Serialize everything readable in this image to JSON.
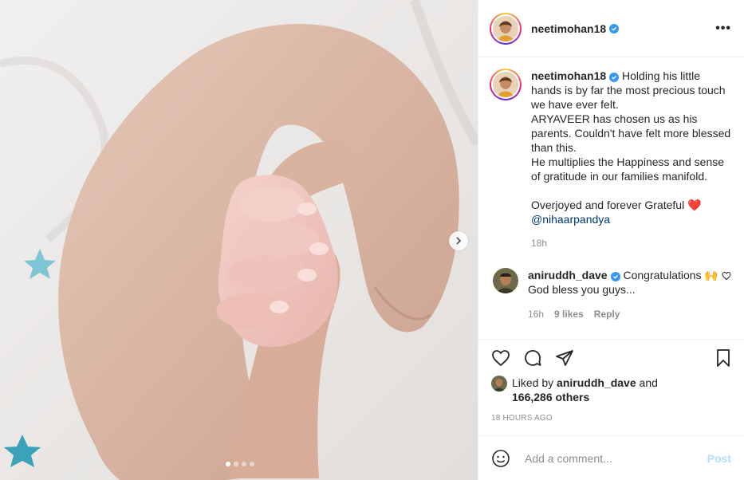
{
  "header": {
    "username": "neetimohan18",
    "more_icon": "ellipsis-icon",
    "more_label": "•••"
  },
  "caption": {
    "username": "neetimohan18",
    "lines": [
      "Holding his little hands is by far the most precious touch we have ever felt.",
      "ARYAVEER has chosen us as his parents. Couldn't have felt more blessed than this.",
      "He multiplies the Happiness and sense of gratitude in our families manifold."
    ],
    "closing": "Overjoyed and forever Grateful",
    "closing_emoji": "❤️",
    "mention": "@nihaarpandya",
    "time": "18h"
  },
  "comment": {
    "username": "aniruddh_dave",
    "text": "Congratulations 🙌God bless you guys...",
    "time": "16h",
    "likes": "9 likes",
    "reply": "Reply"
  },
  "likes": {
    "prefix": "Liked by",
    "user": "aniruddh_dave",
    "and": "and",
    "others": "166,286 others"
  },
  "timestamp": "18 HOURS AGO",
  "add_comment": {
    "placeholder": "Add a comment...",
    "post_label": "Post"
  },
  "carousel": {
    "slide_count": 4,
    "active_slide": 1
  },
  "colors": {
    "verified": "#3897f0",
    "post_button": "#b2dffc",
    "heart": "#ed1c24"
  }
}
